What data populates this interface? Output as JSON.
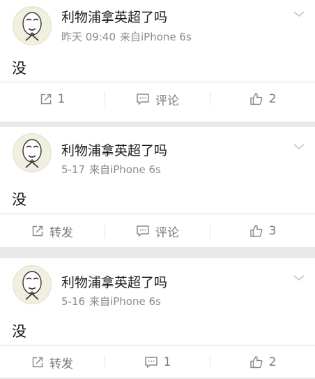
{
  "posts": [
    {
      "author": "利物浦拿英超了吗",
      "time": "昨天 09:40",
      "source": "来自iPhone 6s",
      "text": "没",
      "share": "1",
      "comment": "评论",
      "like": "2"
    },
    {
      "author": "利物浦拿英超了吗",
      "time": "5-17",
      "source": "来自iPhone 6s",
      "text": "没",
      "share": "转发",
      "comment": "评论",
      "like": "3"
    },
    {
      "author": "利物浦拿英超了吗",
      "time": "5-16",
      "source": "来自iPhone 6s",
      "text": "没",
      "share": "转发",
      "comment": "1",
      "like": "2"
    }
  ],
  "icons": {
    "avatar": "meme-face-avatar",
    "menu": "chevron-down-icon",
    "share": "share-icon",
    "comment": "comment-icon",
    "like": "thumbs-up-icon"
  },
  "colors": {
    "background": "#e9e9e9",
    "card": "#ffffff",
    "meta_text": "#8a8a8a",
    "action_text": "#7a7a7a"
  }
}
